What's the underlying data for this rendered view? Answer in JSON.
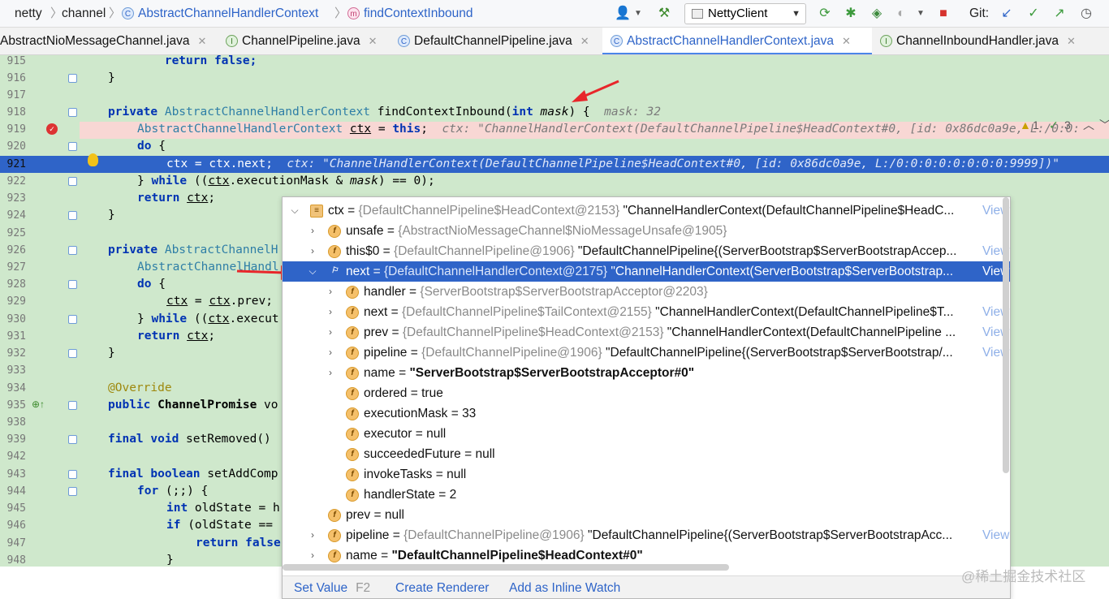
{
  "breadcrumbs": [
    "netty",
    "channel",
    "AbstractChannelHandlerContext",
    "findContextInbound"
  ],
  "toolbar": {
    "run_config": "NettyClient",
    "git_label": "Git:"
  },
  "tabs": [
    {
      "label": "AbstractNioMessageChannel.java",
      "badge": "C"
    },
    {
      "label": "ChannelPipeline.java",
      "badge": "I"
    },
    {
      "label": "DefaultChannelPipeline.java",
      "badge": "C"
    },
    {
      "label": "AbstractChannelHandlerContext.java",
      "badge": "C",
      "active": true
    },
    {
      "label": "ChannelInboundHandler.java",
      "badge": "I"
    }
  ],
  "inspections": {
    "warnings": "1",
    "weak": "3"
  },
  "line_numbers": [
    "915",
    "916",
    "917",
    "918",
    "919",
    "920",
    "921",
    "922",
    "923",
    "924",
    "925",
    "926",
    "927",
    "928",
    "929",
    "930",
    "931",
    "932",
    "933",
    "934",
    "935",
    "938",
    "939",
    "942",
    "943",
    "944",
    "945",
    "946",
    "947",
    "948"
  ],
  "code": {
    "l915": "    return false;",
    "l916": "}",
    "l918_kw": "private ",
    "l918_type": "AbstractChannelHandlerContext",
    "l918_rest": " findContextInbound(",
    "l918_int": "int ",
    "l918_param": "mask",
    "l918_end": ") {",
    "l918_hint": "mask: 32",
    "l919_type": "AbstractChannelHandlerContext",
    "l919_var": "ctx",
    "l919_eq": " = ",
    "l919_this": "this",
    "l919_semi": ";",
    "l919_hint": "ctx: \"ChannelHandlerContext(DefaultChannelPipeline$HeadContext#0, [id: 0x86dc0a9e, L:/0:0:",
    "l920_do": "do",
    "l920_brace": " {",
    "l921_code": "ctx = ctx.next;",
    "l921_hint": "ctx: \"ChannelHandlerContext(DefaultChannelPipeline$HeadContext#0, [id: 0x86dc0a9e, L:/0:0:0:0:0:0:0:0:9999])\"",
    "l922_a": "} ",
    "l922_while": "while",
    "l922_b": " ((",
    "l922_ctx": "ctx",
    "l922_c": ".executionMask & ",
    "l922_mask": "mask",
    "l922_d": ") == 0);",
    "l923_return": "return ",
    "l923_ctx": "ctx",
    "l923_semi": ";",
    "l924": "}",
    "l926_kw": "private ",
    "l926_type": "AbstractChannelH",
    "l927_type": "AbstractChannelHandl",
    "l928_do": "do",
    "l928_brace": " {",
    "l929_a": "ctx",
    "l929_b": " = ",
    "l929_c": "ctx",
    "l929_d": ".prev;",
    "l930_a": "} ",
    "l930_while": "while",
    "l930_b": " ((",
    "l930_ctx": "ctx",
    "l930_c": ".execut",
    "l931_return": "return ",
    "l931_ctx": "ctx",
    "l931_semi": ";",
    "l932": "}",
    "l934": "@Override",
    "l935_kw": "public ",
    "l935_type": "ChannelPromise",
    "l935_rest": " vo",
    "l939_kw": "final void ",
    "l939_rest": "setRemoved()",
    "l943_kw": "final boolean ",
    "l943_rest": "setAddComp",
    "l944_for": "for",
    "l944_rest": " (;;) {",
    "l945_int": "int ",
    "l945_rest": "oldState = h",
    "l946_if": "if",
    "l946_rest": " (oldState ==",
    "l947_return": "return ",
    "l947_false": "false",
    "l948": "}"
  },
  "debugger_popup": {
    "rows": [
      {
        "arrow": "⌵",
        "icon": "list",
        "name": "ctx",
        "eq": " = ",
        "ref": "{DefaultChannelPipeline$HeadContext@2153}",
        "value": " \"ChannelHandlerContext(DefaultChannelPipeline$HeadC...",
        "link": "View"
      },
      {
        "arrow": "›",
        "icon": "f",
        "name": "unsafe",
        "eq": " = ",
        "ref": "{AbstractNioMessageChannel$NioMessageUnsafe@1905}",
        "value": "",
        "link": ""
      },
      {
        "arrow": "›",
        "icon": "f",
        "name": "this$0",
        "eq": " = ",
        "ref": "{DefaultChannelPipeline@1906}",
        "value": " \"DefaultChannelPipeline{(ServerBootstrap$ServerBootstrapAccep...",
        "link": "View"
      },
      {
        "arrow": "⌵",
        "icon": "flag",
        "name": "next",
        "eq": " = ",
        "ref": "{DefaultChannelHandlerContext@2175}",
        "value": " \"ChannelHandlerContext(ServerBootstrap$ServerBootstrap...",
        "link": "View",
        "selected": true
      },
      {
        "arrow": "›",
        "icon": "f",
        "name": "handler",
        "eq": " = ",
        "ref": "{ServerBootstrap$ServerBootstrapAcceptor@2203}",
        "value": "",
        "link": ""
      },
      {
        "arrow": "›",
        "icon": "f",
        "name": "next",
        "eq": " = ",
        "ref": "{DefaultChannelPipeline$TailContext@2155}",
        "value": " \"ChannelHandlerContext(DefaultChannelPipeline$T...",
        "link": "View"
      },
      {
        "arrow": "›",
        "icon": "f",
        "name": "prev",
        "eq": " = ",
        "ref": "{DefaultChannelPipeline$HeadContext@2153}",
        "value": " \"ChannelHandlerContext(DefaultChannelPipeline ...",
        "link": "View"
      },
      {
        "arrow": "›",
        "icon": "f",
        "name": "pipeline",
        "eq": " = ",
        "ref": "{DefaultChannelPipeline@1906}",
        "value": " \"DefaultChannelPipeline{(ServerBootstrap$ServerBootstrap/...",
        "link": "View"
      },
      {
        "arrow": "›",
        "icon": "f",
        "name": "name",
        "eq": " = ",
        "ref": "",
        "value": "\"ServerBootstrap$ServerBootstrapAcceptor#0\"",
        "bold": true,
        "link": ""
      },
      {
        "arrow": "",
        "icon": "f",
        "name": "ordered",
        "eq": " = ",
        "ref": "",
        "value": "true",
        "link": ""
      },
      {
        "arrow": "",
        "icon": "f",
        "name": "executionMask",
        "eq": " = ",
        "ref": "",
        "value": "33",
        "link": ""
      },
      {
        "arrow": "",
        "icon": "f",
        "name": "executor",
        "eq": " = ",
        "ref": "",
        "value": "null",
        "link": ""
      },
      {
        "arrow": "",
        "icon": "f",
        "name": "succeededFuture",
        "eq": " = ",
        "ref": "",
        "value": "null",
        "link": ""
      },
      {
        "arrow": "",
        "icon": "f",
        "name": "invokeTasks",
        "eq": " = ",
        "ref": "",
        "value": "null",
        "link": ""
      },
      {
        "arrow": "",
        "icon": "f",
        "name": "handlerState",
        "eq": " = ",
        "ref": "",
        "value": "2",
        "link": ""
      },
      {
        "arrow": "",
        "icon": "f",
        "name": "prev",
        "eq": " = ",
        "ref": "",
        "value": "null",
        "link": ""
      },
      {
        "arrow": "›",
        "icon": "f",
        "name": "pipeline",
        "eq": " = ",
        "ref": "{DefaultChannelPipeline@1906}",
        "value": " \"DefaultChannelPipeline{(ServerBootstrap$ServerBootstrapAcc...",
        "link": "View"
      },
      {
        "arrow": "›",
        "icon": "f",
        "name": "name",
        "eq": " = ",
        "ref": "",
        "value": "\"DefaultChannelPipeline$HeadContext#0\"",
        "bold": true,
        "link": ""
      }
    ],
    "footer": {
      "set_value": "Set Value",
      "set_value_key": "F2",
      "create_renderer": "Create Renderer",
      "add_inline_watch": "Add as Inline Watch"
    }
  },
  "watermark": "@稀土掘金技术社区",
  "colors": {
    "editor_bg": "#cfe8cc",
    "selection": "#2f64c8",
    "link": "#2e64c8",
    "keyword": "#0033b3",
    "arrow_red": "#e8262a"
  }
}
